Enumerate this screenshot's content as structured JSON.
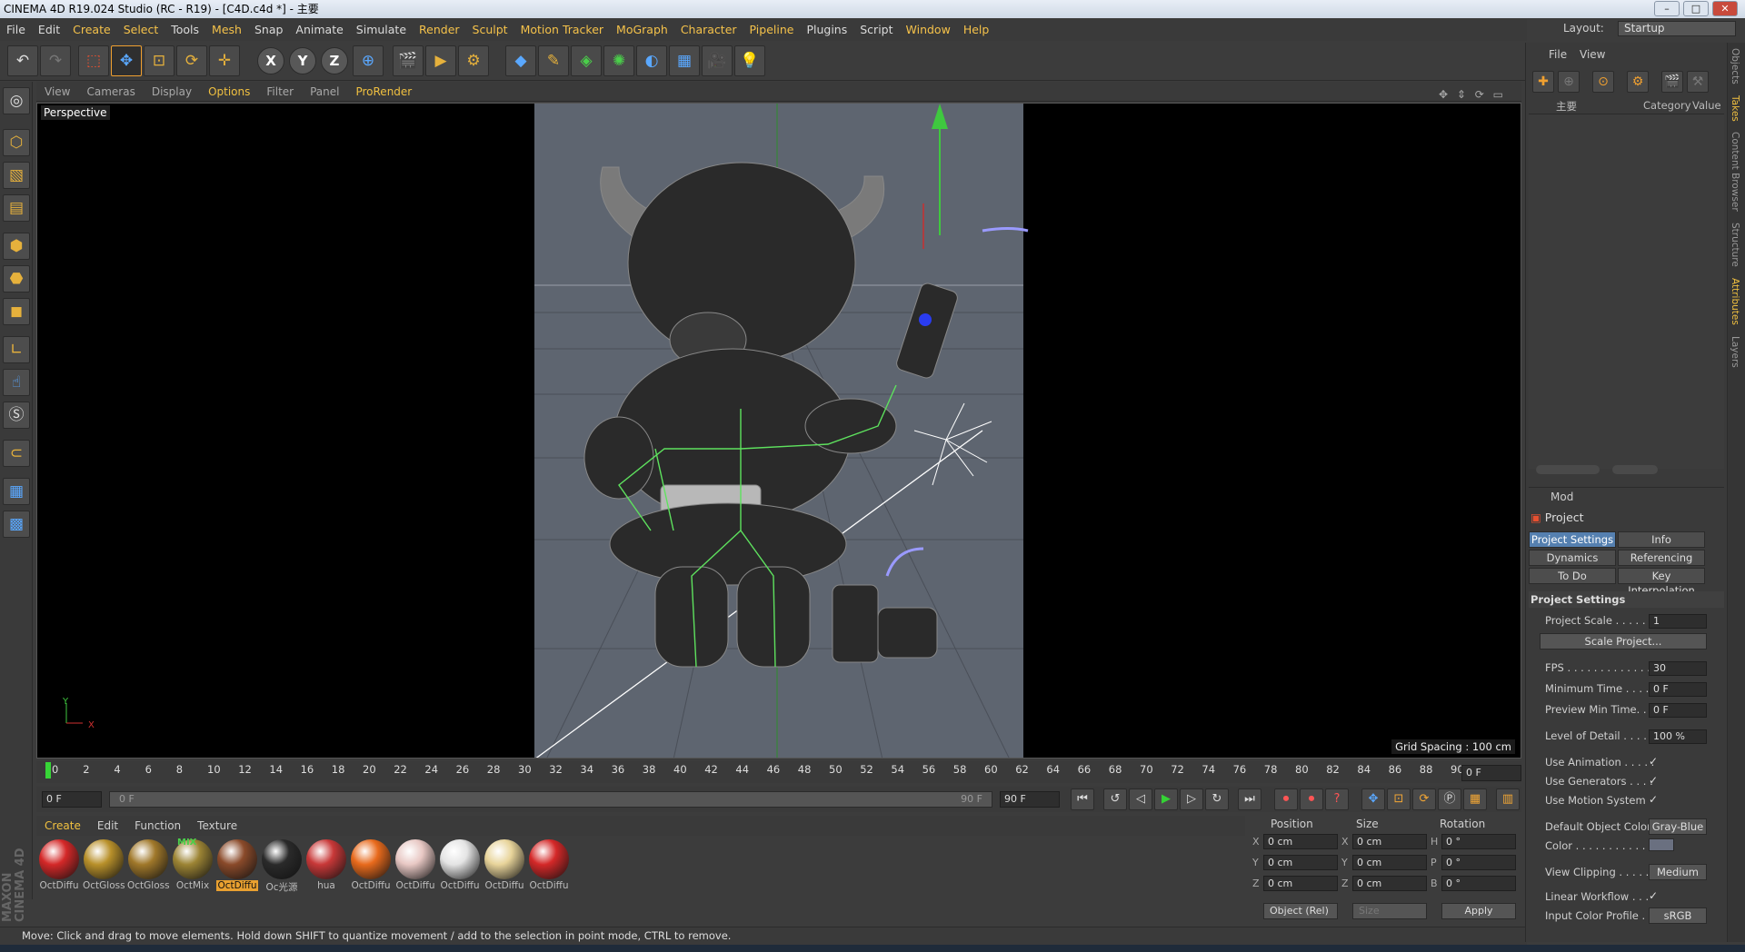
{
  "window": {
    "title": "CINEMA 4D R19.024 Studio (RC - R19) - [C4D.c4d *] - 主要",
    "controls": [
      "–",
      "□",
      "✕"
    ]
  },
  "menu": {
    "items": [
      "File",
      "Edit",
      "Create",
      "Select",
      "Tools",
      "Mesh",
      "Snap",
      "Animate",
      "Simulate",
      "Render",
      "Sculpt",
      "Motion Tracker",
      "MoGraph",
      "Character",
      "Pipeline",
      "Plugins",
      "Script",
      "Window",
      "Help"
    ],
    "layout_label": "Layout:",
    "layout_value": "Startup"
  },
  "toolbar": {
    "axis_x": "X",
    "axis_y": "Y",
    "axis_z": "Z"
  },
  "viewport": {
    "menu": [
      "View",
      "Cameras",
      "Display",
      "Options",
      "Filter",
      "Panel",
      "ProRender"
    ],
    "nav_icons": "✥ ⇕ ⟳ ▭",
    "label": "Perspective",
    "grid_spacing": "Grid Spacing : 100 cm",
    "axis_y": "Y",
    "axis_x": "X"
  },
  "timeline": {
    "ticks": [
      "0",
      "2",
      "4",
      "6",
      "8",
      "10",
      "12",
      "14",
      "16",
      "18",
      "20",
      "22",
      "24",
      "26",
      "28",
      "30",
      "32",
      "34",
      "36",
      "38",
      "40",
      "42",
      "44",
      "46",
      "48",
      "50",
      "52",
      "54",
      "56",
      "58",
      "60",
      "62",
      "64",
      "66",
      "68",
      "70",
      "72",
      "74",
      "76",
      "78",
      "80",
      "82",
      "84",
      "86",
      "88",
      "90"
    ],
    "current_frame": "0 F",
    "start_frame": "0 F",
    "scrub_start": "0 F",
    "scrub_end": "90 F",
    "end_frame": "90 F"
  },
  "materials": {
    "menu": [
      "Create",
      "Edit",
      "Function",
      "Texture"
    ],
    "items": [
      {
        "name": "OctDiffu",
        "color": "#d42828"
      },
      {
        "name": "OctGloss",
        "color": "#b8902a"
      },
      {
        "name": "OctGloss",
        "color": "#a0782a"
      },
      {
        "name": "OctMix",
        "color": "#9c8434"
      },
      {
        "name": "OctDiffu",
        "color": "#8a4a2a"
      },
      {
        "name": "Oc光源",
        "color": "#2a2a2a"
      },
      {
        "name": "hua",
        "color": "#c83838"
      },
      {
        "name": "OctDiffu",
        "color": "#e86a1c"
      },
      {
        "name": "OctDiffu",
        "color": "#e8c8c4"
      },
      {
        "name": "OctDiffu",
        "color": "#e4e4e4"
      },
      {
        "name": "OctDiffu",
        "color": "#e8d49a"
      },
      {
        "name": "OctDiffu",
        "color": "#d42828"
      }
    ],
    "mix_badge": "MIX"
  },
  "coords": {
    "headers": [
      "Position",
      "Size",
      "Rotation"
    ],
    "rows": [
      {
        "axis": "X",
        "pos": "0 cm",
        "saxis": "X",
        "size": "0 cm",
        "raxis": "H",
        "rot": "0 °"
      },
      {
        "axis": "Y",
        "pos": "0 cm",
        "saxis": "Y",
        "size": "0 cm",
        "raxis": "P",
        "rot": "0 °"
      },
      {
        "axis": "Z",
        "pos": "0 cm",
        "saxis": "Z",
        "size": "0 cm",
        "raxis": "B",
        "rot": "0 °"
      }
    ],
    "mode": "Object (Rel)",
    "size_mode": "Size",
    "apply": "Apply"
  },
  "status": "Move: Click and drag to move elements. Hold down SHIFT to quantize movement / add to the selection in point mode, CTRL to remove.",
  "brand": "MAXON CINEMA 4D",
  "takes": {
    "menu": [
      "File",
      "View"
    ],
    "col_main": "主要",
    "col_category": "Category",
    "col_value": "Value"
  },
  "attributes": {
    "mode": "Mod",
    "object": "Project",
    "tabs": [
      "Project Settings",
      "Info",
      "Dynamics",
      "Referencing",
      "To Do",
      "Key Interpolation"
    ],
    "section": "Project Settings",
    "rows": {
      "scale_label": "Project Scale . . . . . .",
      "scale_value": "1",
      "scale_button": "Scale Project...",
      "fps_label": "FPS . . . . . . . . . . . . . . .",
      "fps_value": "30",
      "min_label": "Minimum Time . . . . .",
      "min_value": "0 F",
      "pmin_label": "Preview Min Time. . .",
      "pmin_value": "0 F",
      "lod_label": "Level of Detail . . . . .",
      "lod_value": "100 %",
      "anim_label": "Use Animation . . . . .",
      "gen_label": "Use Generators . . . .",
      "motion_label": "Use Motion System",
      "check": "✓",
      "doc_label": "Default Object Color",
      "doc_value": "Gray-Blue",
      "color_label": "Color . . . . . . . . . . .",
      "clip_label": "View Clipping . . . . .",
      "clip_value": "Medium",
      "linear_label": "Linear Workflow . . .",
      "icp_label": "Input Color Profile . .",
      "icp_value": "sRGB"
    }
  },
  "side_tabs": [
    "Objects",
    "Takes",
    "Content Browser",
    "Structure",
    "Attributes",
    "Layers"
  ],
  "colors": {
    "accent": "#f0c040",
    "selected_tab": "#5580b0",
    "playhead": "#37d637"
  }
}
